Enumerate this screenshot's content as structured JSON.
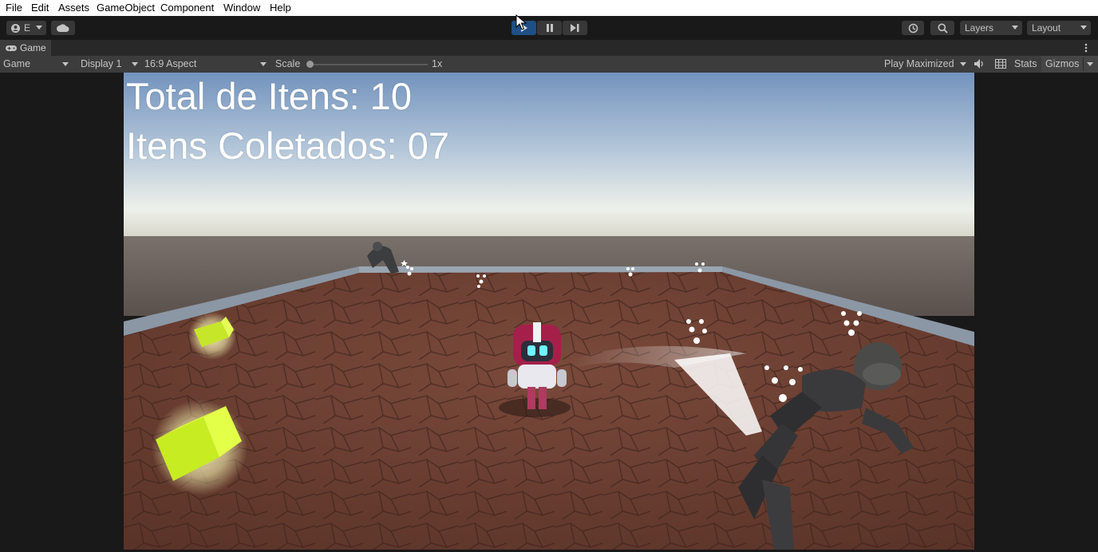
{
  "menu": [
    "File",
    "Edit",
    "Assets",
    "GameObject",
    "Component",
    "Window",
    "Help"
  ],
  "toolbar": {
    "account_label": "E",
    "layers_label": "Layers",
    "layout_label": "Layout"
  },
  "tab": {
    "label": "Game"
  },
  "gamebar": {
    "mode": "Game",
    "display": "Display 1",
    "aspect": "16:9 Aspect",
    "scale_label": "Scale",
    "scale_value": "1x",
    "play_mode": "Play Maximized",
    "stats": "Stats",
    "gizmos": "Gizmos"
  },
  "hud": {
    "total_items": "Total de Itens: 10",
    "collected_items": "Itens Coletados: 07"
  },
  "colors": {
    "play_active": "#1e4f86",
    "pickup": "#d8ff2a",
    "floor": "#6b3f33"
  }
}
